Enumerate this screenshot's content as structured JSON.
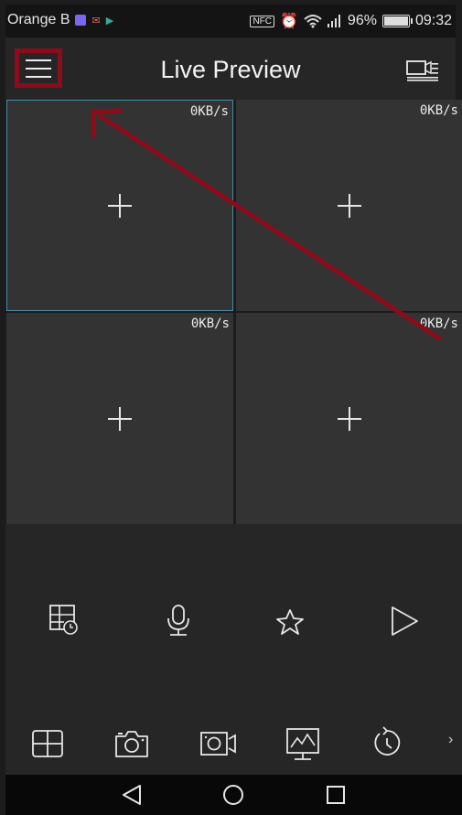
{
  "status_bar": {
    "carrier": "Orange B",
    "nfc_label": "NFC",
    "battery": "96%",
    "time": "09:32"
  },
  "app_bar": {
    "title": "Live Preview",
    "menu_icon": "hamburger-menu-icon",
    "record_icon": "camera-list-icon"
  },
  "grid": {
    "cells": [
      {
        "rate": "0KB/s",
        "selected": true
      },
      {
        "rate": "0KB/s",
        "selected": false
      },
      {
        "rate": "0KB/s",
        "selected": false
      },
      {
        "rate": "0KB/s",
        "selected": false
      }
    ]
  },
  "controls": {
    "row1": [
      "playback-schedule-icon",
      "microphone-icon",
      "favorite-star-icon",
      "play-icon"
    ],
    "row2": [
      "grid-layout-icon",
      "snapshot-camera-icon",
      "video-record-icon",
      "monitor-icon",
      "timer-icon"
    ]
  },
  "annotation": {
    "color": "#8b0d1c"
  },
  "colors": {
    "accent": "#3e8fa8",
    "highlight": "#8b0d1c",
    "cell": "#333333",
    "panel": "#262626"
  }
}
